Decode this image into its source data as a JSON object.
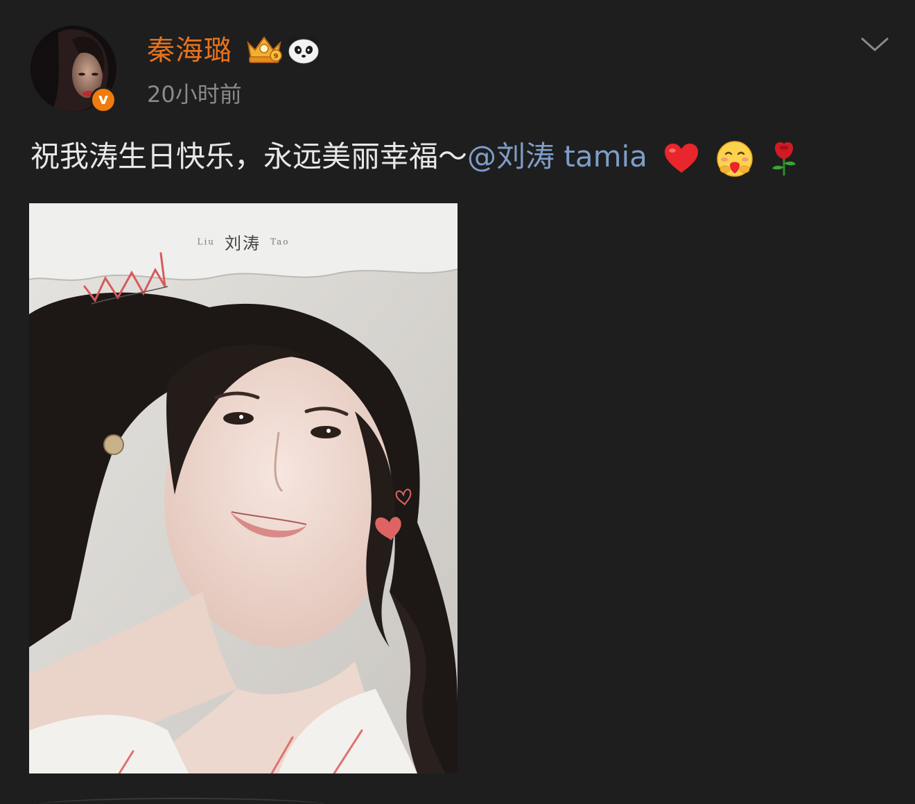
{
  "post": {
    "author": {
      "name": "秦海璐",
      "avatar_icon": "avatar-portrait",
      "verified_badge_letter": "v",
      "verified_color": "#f07b0f"
    },
    "timestamp": "20小时前",
    "text": "祝我涛生日快乐，永远美丽幸福～",
    "mention": "@刘涛 tamia",
    "emojis": [
      "heart-emoji",
      "hugging-face-emoji",
      "rose-emoji"
    ],
    "photo": {
      "caption_left": "Liu",
      "caption_main": "刘涛",
      "caption_right": "Tao"
    }
  },
  "colors": {
    "background": "#1e1e1e",
    "username": "#e8731e",
    "mention": "#7f9dc9",
    "text": "#e8e8e8",
    "meta": "#8a8a8a"
  }
}
